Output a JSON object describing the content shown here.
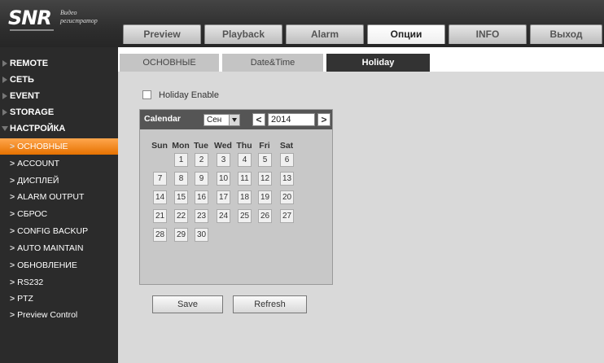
{
  "logo": {
    "brand": "SNR",
    "line1": "Видео",
    "line2": "регистратор"
  },
  "top_tabs": [
    "Preview",
    "Playback",
    "Alarm",
    "Опции",
    "INFO",
    "Выход"
  ],
  "active_top_tab": "Опции",
  "sidebar": {
    "top_items": [
      "REMOTE",
      "СЕТЬ",
      "EVENT",
      "STORAGE",
      "НАСТРОЙКА"
    ],
    "sub_items": [
      "ОСНОВНЫЕ",
      "ACCOUNT",
      "ДИСПЛЕЙ",
      "ALARM OUTPUT",
      "СБРОС",
      "CONFIG BACKUP",
      "AUTO MAINTAIN",
      "ОБНОВЛЕНИЕ",
      "RS232",
      "PTZ",
      "Preview Control"
    ],
    "active_sub_item": "ОСНОВНЫЕ"
  },
  "sub_tabs": [
    "ОСНОВНЫЕ",
    "Date&Time",
    "Holiday"
  ],
  "active_sub_tab": "Holiday",
  "holiday_enable": {
    "label": "Holiday Enable",
    "checked": false
  },
  "calendar": {
    "title": "Calendar",
    "month": "Сен",
    "year": "2014",
    "prev_symbol": "<",
    "next_symbol": ">",
    "weekdays": [
      "Sun",
      "Mon",
      "Tue",
      "Wed",
      "Thu",
      "Fri",
      "Sat"
    ],
    "first_weekday_index": 1,
    "days": [
      "1",
      "2",
      "3",
      "4",
      "5",
      "6",
      "7",
      "8",
      "9",
      "10",
      "11",
      "12",
      "13",
      "14",
      "15",
      "16",
      "17",
      "18",
      "19",
      "20",
      "21",
      "22",
      "23",
      "24",
      "25",
      "26",
      "27",
      "28",
      "29",
      "30"
    ]
  },
  "buttons": {
    "save": "Save",
    "refresh": "Refresh"
  }
}
